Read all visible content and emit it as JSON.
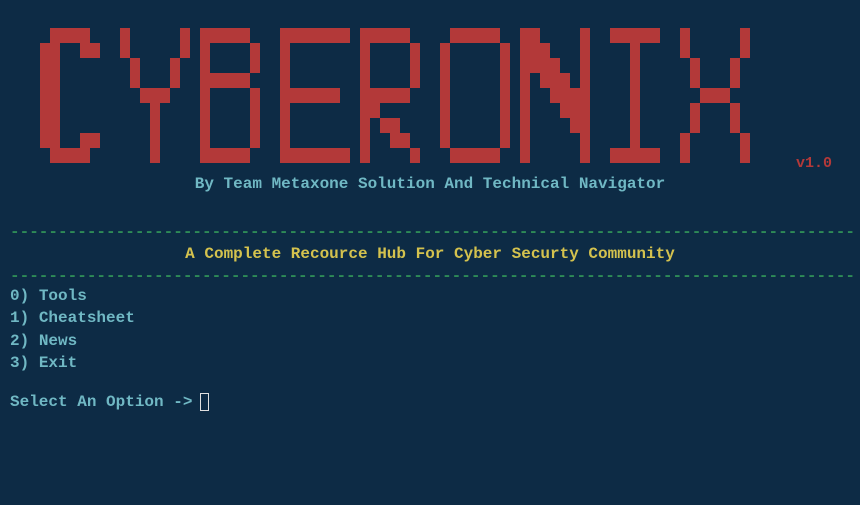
{
  "banner": {
    "ascii_title": "CYBERONIX",
    "version": "v1.0",
    "byline": "By Team Metaxone Solution And Technical Navigator"
  },
  "tagline": "A Complete Recource Hub For Cyber Securty Community",
  "separator": "----------------------------------------------------------------------------------------",
  "menu": {
    "items": [
      {
        "index": "0)",
        "label": "Tools"
      },
      {
        "index": "1)",
        "label": "Cheatsheet"
      },
      {
        "index": "2)",
        "label": "News"
      },
      {
        "index": "3)",
        "label": "Exit"
      }
    ]
  },
  "prompt": "Select An Option ->",
  "colors": {
    "background": "#0d2b45",
    "accent_red": "#b33939",
    "text_cyan": "#70b8c4",
    "text_yellow": "#d4c24e",
    "text_green": "#2e8b57"
  },
  "ascii_bitmap": [
    "0111100.1000001.1111100.1111111.1111100.0111110.1100001.0111110.1000001",
    "1100110.1000001.1000010.1000000.1000010.1000001.1110001.0001000.1000001",
    "1100000.0100010.1000010.1000000.1000010.1000001.1111001.0001000.0100010",
    "1100000.0100010.1111100.1000000.1000010.1000001.1011101.0001000.0100010",
    "1100000.0011100.1000010.1111110.1111100.1000001.1001111.0001000.0011100",
    "1100000.0001000.1000010.1000000.1100000.1000001.1000111.0001000.0100010",
    "1100000.0001000.1000010.1000000.1011000.1000001.1000011.0001000.0100010",
    "1100110.0001000.1000010.1000000.1001100.1000001.1000001.0001000.1000001",
    "0111100.0001000.1111100.1111111.1000010.0111110.1000001.0111110.1000001"
  ]
}
